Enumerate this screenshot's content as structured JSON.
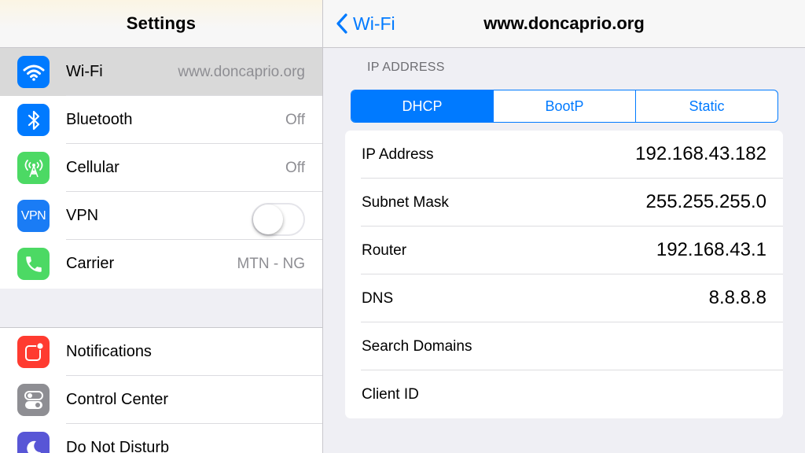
{
  "sidebar": {
    "title": "Settings",
    "group1": [
      {
        "label": "Wi-Fi",
        "value": "www.doncaprio.org",
        "icon": "wifi-icon",
        "color": "#007aff"
      },
      {
        "label": "Bluetooth",
        "value": "Off",
        "icon": "bluetooth-icon",
        "color": "#007aff"
      },
      {
        "label": "Cellular",
        "value": "Off",
        "icon": "cellular-icon",
        "color": "#4cd964"
      },
      {
        "label": "VPN",
        "icon_text": "VPN",
        "icon": "vpn-icon",
        "color": "#1a7cf5",
        "toggle_on": false
      },
      {
        "label": "Carrier",
        "value": "MTN - NG",
        "icon": "phone-icon",
        "color": "#4cd964"
      }
    ],
    "group2": [
      {
        "label": "Notifications",
        "icon": "notifications-icon",
        "color": "#ff3b30"
      },
      {
        "label": "Control Center",
        "icon": "control-center-icon",
        "color": "#8e8e93"
      },
      {
        "label": "Do Not Disturb",
        "icon": "moon-icon",
        "color": "#5856d6"
      }
    ]
  },
  "detail": {
    "back_label": "Wi-Fi",
    "title": "www.doncaprio.org",
    "section_title": "IP ADDRESS",
    "segments": [
      "DHCP",
      "BootP",
      "Static"
    ],
    "active_segment": "DHCP",
    "fields": [
      {
        "label": "IP Address",
        "value": "192.168.43.182"
      },
      {
        "label": "Subnet Mask",
        "value": "255.255.255.0"
      },
      {
        "label": "Router",
        "value": "192.168.43.1"
      },
      {
        "label": "DNS",
        "value": "8.8.8.8"
      },
      {
        "label": "Search Domains",
        "value": ""
      },
      {
        "label": "Client ID",
        "value": ""
      }
    ]
  },
  "colors": {
    "accent": "#007aff",
    "background": "#efeff4",
    "secondary_text": "#8e8e93"
  }
}
